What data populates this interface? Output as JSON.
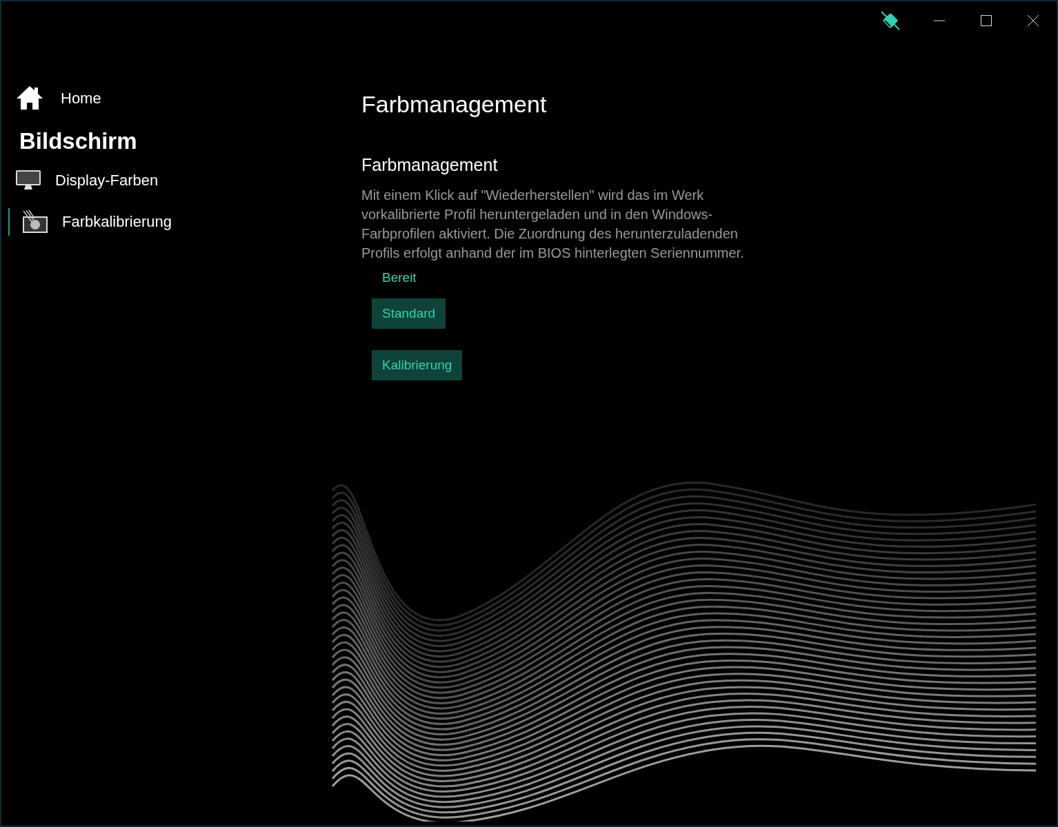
{
  "sidebar": {
    "home": {
      "label": "Home"
    },
    "section_title": "Bildschirm",
    "items": [
      {
        "label": "Display-Farben",
        "selected": false
      },
      {
        "label": "Farbkalibrierung",
        "selected": true
      }
    ]
  },
  "page": {
    "title": "Farbmanagement",
    "section": {
      "heading": "Farbmanagement",
      "description": "Mit einem Klick auf \"Wiederherstellen\" wird das im Werk vorkalibrierte Profil heruntergeladen und in den Windows-Farbprofilen aktiviert. Die Zuordnung des herunterzuladenden Profils erfolgt anhand der im BIOS hinterlegten Seriennummer.",
      "status": "Bereit",
      "buttons": [
        "Standard",
        "Kalibrierung"
      ]
    }
  }
}
